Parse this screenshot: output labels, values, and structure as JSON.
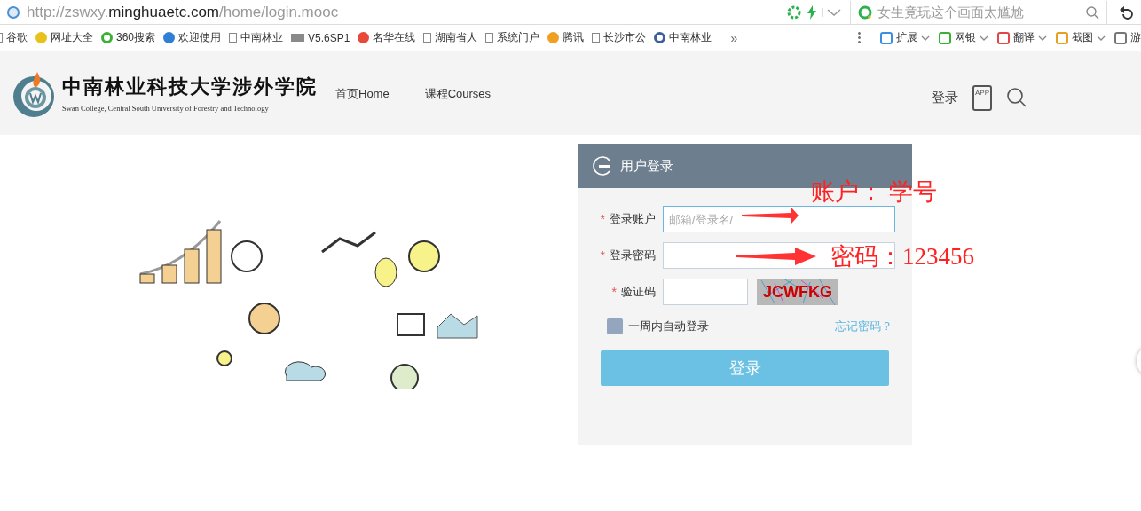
{
  "browser": {
    "url": "http://zswxy.**minghuaetc.com**/home/login.mooc",
    "search_placeholder": "女生竟玩这个画面太尴尬",
    "bookmarks": [
      {
        "label": "谷歌",
        "kind": "page"
      },
      {
        "label": "网址大全",
        "kind": "site",
        "color": "#e8c21a"
      },
      {
        "label": "360搜索",
        "kind": "ring",
        "color": "#3cb034"
      },
      {
        "label": "欢迎使用",
        "kind": "site",
        "color": "#2f7fd6"
      },
      {
        "label": "中南林业",
        "kind": "page"
      },
      {
        "label": "V5.6SP1",
        "kind": "tag",
        "color": "#8a8a8a"
      },
      {
        "label": "名华在线",
        "kind": "site",
        "color": "#e84a3a"
      },
      {
        "label": "湖南省人",
        "kind": "page"
      },
      {
        "label": "系统门户",
        "kind": "page"
      },
      {
        "label": "腾讯",
        "kind": "site",
        "color": "#f0a020"
      },
      {
        "label": "长沙市公",
        "kind": "page"
      },
      {
        "label": "中南林业",
        "kind": "ring",
        "color": "#3a5f9a"
      }
    ],
    "more": "»",
    "tools": [
      {
        "label": "扩展",
        "color": "#3a8ee6",
        "caret": true
      },
      {
        "label": "网银",
        "color": "#3cb034",
        "caret": true
      },
      {
        "label": "翻译",
        "color": "#e04848",
        "caret": true
      },
      {
        "label": "截图",
        "color": "#e8a020",
        "caret": true
      },
      {
        "label": "游",
        "color": "#777777",
        "caret": false
      }
    ]
  },
  "header": {
    "title": "中南林业科技大学涉外学院",
    "subtitle": "Swan College, Central South University of Forestry and Technology",
    "nav": [
      {
        "label": "首页Home"
      },
      {
        "label": "课程Courses"
      }
    ],
    "login": "登录",
    "app": "APP"
  },
  "login": {
    "title": "用户登录",
    "required_mark": "*",
    "fields": [
      {
        "label": "登录账户",
        "required": true,
        "kind": "text",
        "placeholder": "邮箱/登录名/",
        "focused": true
      },
      {
        "label": "登录密码",
        "required": true,
        "kind": "text",
        "focused": false
      },
      {
        "label": "验证码",
        "required": true,
        "kind": "captcha",
        "captcha": "JCWFKG",
        "focused": false
      }
    ],
    "remember": {
      "label": "一周内自动登录",
      "checked": false
    },
    "forgot": "忘记密码？",
    "submit": "登录"
  },
  "annotations": [
    {
      "text": "账户：  学号"
    },
    {
      "text": "密码：123456"
    }
  ]
}
